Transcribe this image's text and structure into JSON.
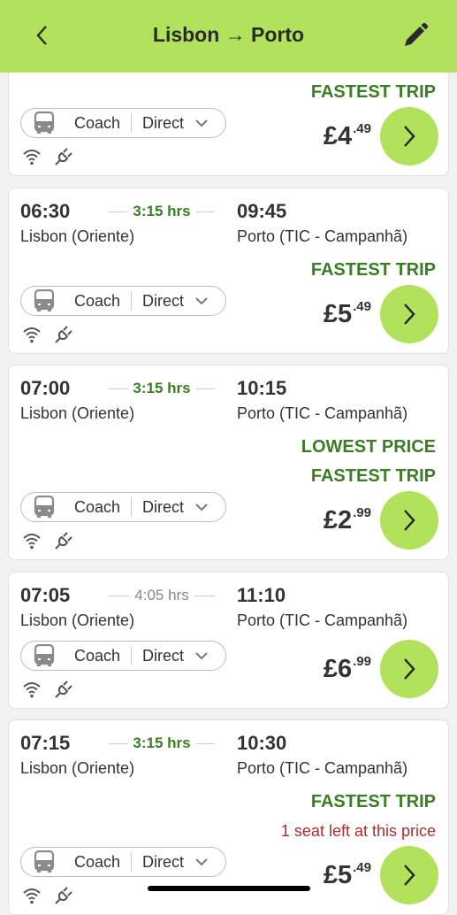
{
  "header": {
    "title": "Lisbon → Porto",
    "back_icon": "chevron-left-icon",
    "edit_icon": "pencil-icon",
    "bg_color": "#b2e25c"
  },
  "colors": {
    "accent": "#b2e25c",
    "label_green": "#3a7d22",
    "warning_red": "#b22a2a"
  },
  "trips": [
    {
      "depart": "",
      "duration": "",
      "fast": false,
      "arrive": "",
      "from": "",
      "to": "",
      "labels": [
        "FASTEST TRIP"
      ],
      "warning": "",
      "mode": "Coach",
      "route": "Direct",
      "price_main": "£4",
      "price_cents": ".49",
      "amenities": [
        "wifi-icon",
        "plug-icon"
      ]
    },
    {
      "depart": "06:30",
      "duration": "3:15 hrs",
      "fast": true,
      "arrive": "09:45",
      "from": "Lisbon (Oriente)",
      "to": "Porto (TIC - Campanhã)",
      "labels": [
        "FASTEST TRIP"
      ],
      "warning": "",
      "mode": "Coach",
      "route": "Direct",
      "price_main": "£5",
      "price_cents": ".49",
      "amenities": [
        "wifi-icon",
        "plug-icon"
      ]
    },
    {
      "depart": "07:00",
      "duration": "3:15 hrs",
      "fast": true,
      "arrive": "10:15",
      "from": "Lisbon (Oriente)",
      "to": "Porto (TIC - Campanhã)",
      "labels": [
        "LOWEST PRICE",
        "FASTEST TRIP"
      ],
      "warning": "",
      "mode": "Coach",
      "route": "Direct",
      "price_main": "£2",
      "price_cents": ".99",
      "amenities": [
        "wifi-icon",
        "plug-icon"
      ]
    },
    {
      "depart": "07:05",
      "duration": "4:05 hrs",
      "fast": false,
      "arrive": "11:10",
      "from": "Lisbon (Oriente)",
      "to": "Porto (TIC - Campanhã)",
      "labels": [],
      "warning": "",
      "mode": "Coach",
      "route": "Direct",
      "price_main": "£6",
      "price_cents": ".99",
      "amenities": [
        "wifi-icon",
        "plug-icon"
      ]
    },
    {
      "depart": "07:15",
      "duration": "3:15 hrs",
      "fast": true,
      "arrive": "10:30",
      "from": "Lisbon (Oriente)",
      "to": "Porto (TIC - Campanhã)",
      "labels": [
        "FASTEST TRIP"
      ],
      "warning": "1 seat left at this price",
      "mode": "Coach",
      "route": "Direct",
      "price_main": "£5",
      "price_cents": ".49",
      "amenities": [
        "wifi-icon",
        "plug-icon"
      ]
    }
  ]
}
